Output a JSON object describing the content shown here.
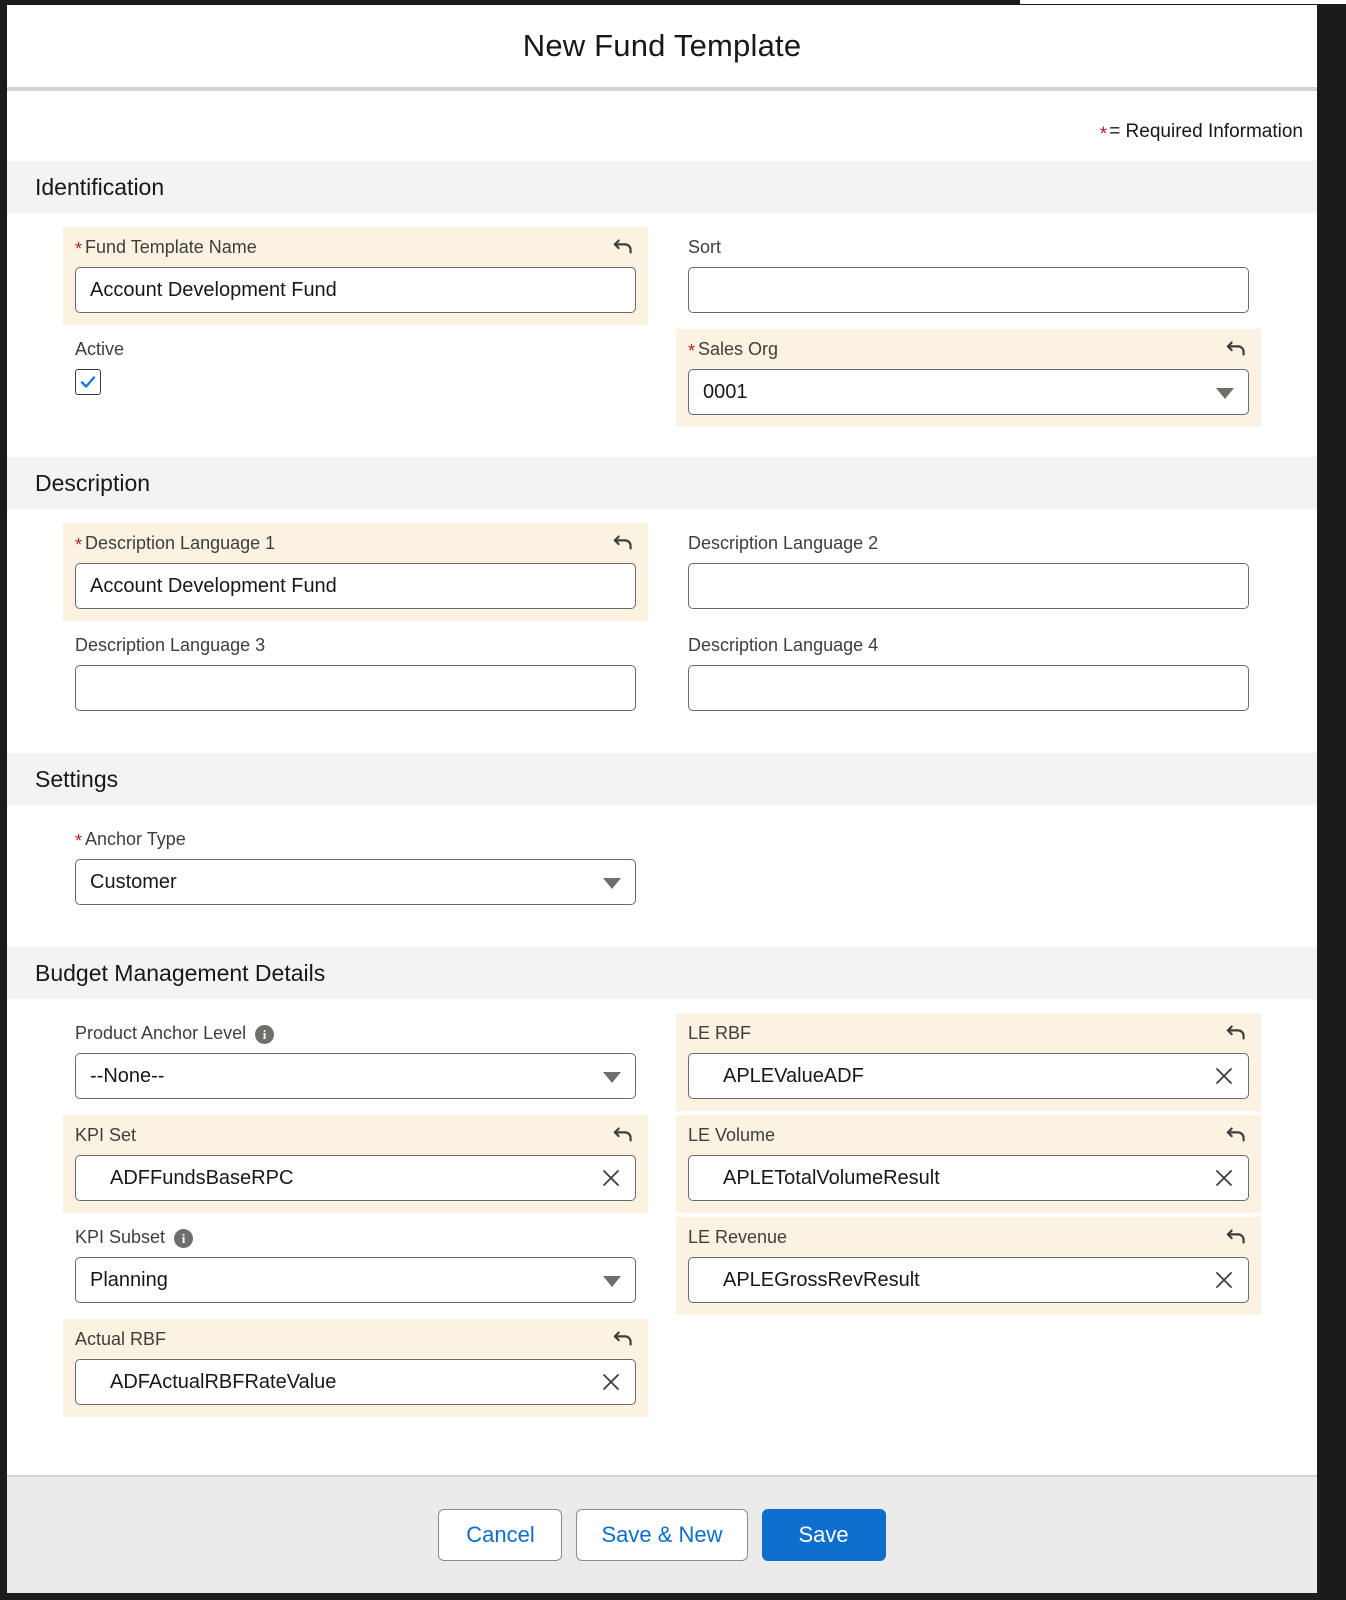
{
  "modal": {
    "title": "New Fund Template",
    "required_note_star": "*",
    "required_note_text": "= Required Information"
  },
  "sections": {
    "identification": {
      "header": "Identification",
      "fund_template_name": {
        "label": "Fund Template Name",
        "value": "Account Development Fund",
        "required_star": "*"
      },
      "active": {
        "label": "Active",
        "checked": true
      },
      "sort": {
        "label": "Sort",
        "value": ""
      },
      "sales_org": {
        "label": "Sales Org",
        "value": "0001",
        "required_star": "*"
      }
    },
    "description": {
      "header": "Description",
      "lang1": {
        "label": "Description Language 1",
        "value": "Account Development Fund",
        "required_star": "*"
      },
      "lang2": {
        "label": "Description Language 2",
        "value": ""
      },
      "lang3": {
        "label": "Description Language 3",
        "value": ""
      },
      "lang4": {
        "label": "Description Language 4",
        "value": ""
      }
    },
    "settings": {
      "header": "Settings",
      "anchor_type": {
        "label": "Anchor Type",
        "value": "Customer",
        "required_star": "*"
      }
    },
    "budget": {
      "header": "Budget Management Details",
      "product_anchor_level": {
        "label": "Product Anchor Level",
        "value": "--None--",
        "info": "i"
      },
      "kpi_set": {
        "label": "KPI Set",
        "value": "ADFFundsBaseRPC"
      },
      "kpi_subset": {
        "label": "KPI Subset",
        "value": "Planning",
        "info": "i"
      },
      "actual_rbf": {
        "label": "Actual RBF",
        "value": "ADFActualRBFRateValue"
      },
      "le_rbf": {
        "label": "LE RBF",
        "value": "APLEValueADF"
      },
      "le_volume": {
        "label": "LE Volume",
        "value": "APLETotalVolumeResult"
      },
      "le_revenue": {
        "label": "LE Revenue",
        "value": "APLEGrossRevResult"
      }
    }
  },
  "footer": {
    "cancel": "Cancel",
    "save_new": "Save & New",
    "save": "Save"
  },
  "colors": {
    "highlight": "#fbf2e2",
    "section_header_bg": "#f3f3f3",
    "required_star": "#b5231f",
    "primary": "#0d6ecd",
    "footer_bg": "#ebebeb"
  },
  "icons": {
    "undo": "undo-icon",
    "clear": "clear-icon",
    "info": "info-icon",
    "caret": "chevron-down-icon",
    "check": "check-icon"
  }
}
